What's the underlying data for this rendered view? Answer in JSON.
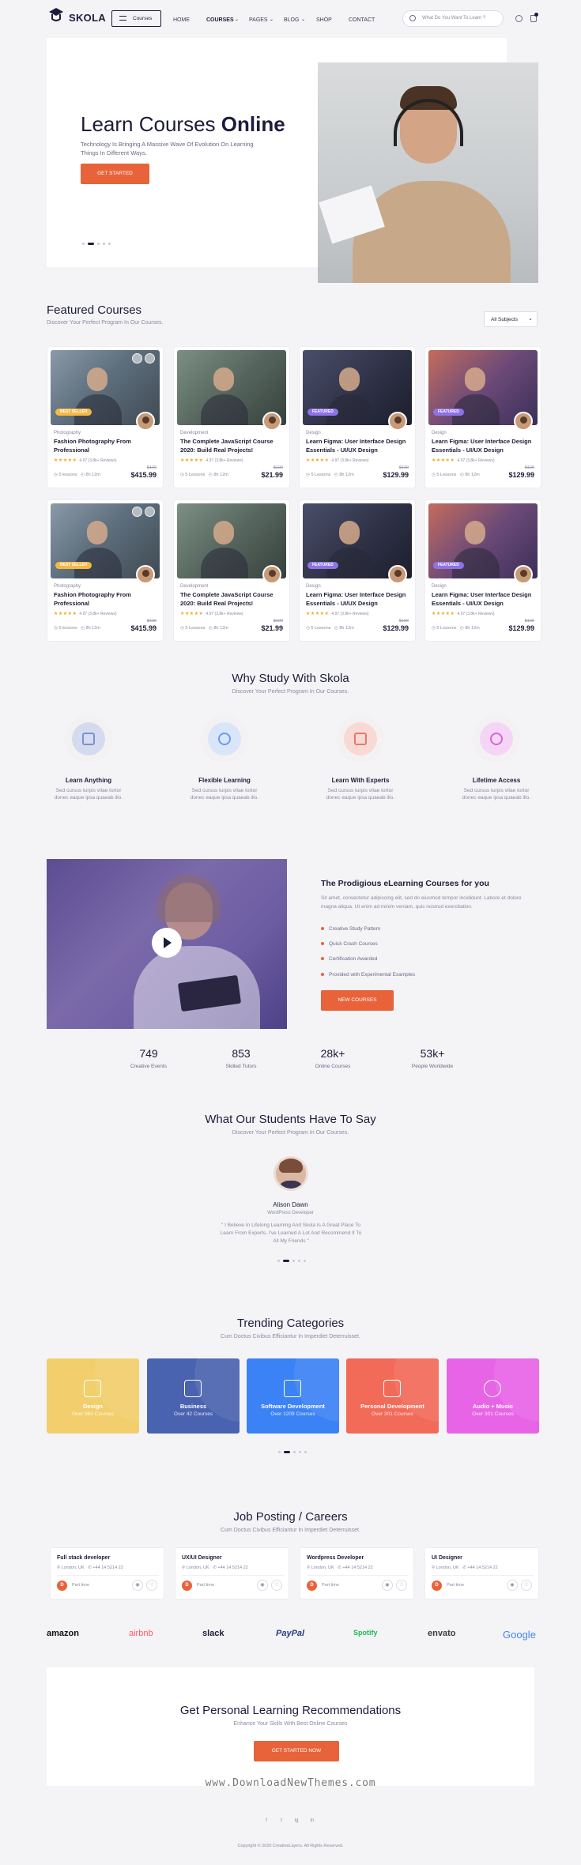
{
  "header": {
    "brand": "SKOLA",
    "courses_button": "Courses",
    "nav": [
      "HOME",
      "COURSES",
      "PAGES",
      "BLOG",
      "SHOP",
      "CONTACT"
    ],
    "search_placeholder": "What Do You Want To Learn ?"
  },
  "hero": {
    "title_light": "Learn Courses ",
    "title_bold": "Online",
    "subtitle": "Technology Is Bringing A Massive Wave Of Evolution On Learning Things In Different Ways.",
    "cta": "GET STARTED"
  },
  "featured": {
    "title": "Featured Courses",
    "subtitle": "Discover Your Perfect Program In Our Courses.",
    "filter": "All Subjects",
    "courses": [
      {
        "badge": "BEST SELLER",
        "category": "Photography",
        "title": "Fashion Photography From Professional",
        "rating": "4.97 (3.8k+ Reviews)",
        "old_price": "$120",
        "lessons": "5 lessons",
        "duration": "8h 12m",
        "price": "$415.99"
      },
      {
        "badge": "",
        "category": "Development",
        "title": "The Complete JavaScript Course 2020: Build Real Projects!",
        "rating": "4.97 (3.8k+ Reviews)",
        "old_price": "$120",
        "lessons": "5 Lessons",
        "duration": "8h 12m",
        "price": "$21.99"
      },
      {
        "badge": "FEATURED",
        "category": "Design",
        "title": "Learn Figma: User Interface Design Essentials - UI/UX Design",
        "rating": "4.97 (3.8k+ Reviews)",
        "old_price": "$120",
        "lessons": "5 Lessons",
        "duration": "8h 12m",
        "price": "$129.99"
      },
      {
        "badge": "FEATURED",
        "category": "Design",
        "title": "Learn Figma: User Interface Design Essentials - UI/UX Design",
        "rating": "4.97 (3.8k+ Reviews)",
        "old_price": "$120",
        "lessons": "5 Lessons",
        "duration": "8h 12m",
        "price": "$129.99"
      },
      {
        "badge": "BEST SELLER",
        "category": "Photography",
        "title": "Fashion Photography From Professional",
        "rating": "4.97 (3.8k+ Reviews)",
        "old_price": "$120",
        "lessons": "5 lessons",
        "duration": "8h 12m",
        "price": "$415.99"
      },
      {
        "badge": "",
        "category": "Development",
        "title": "The Complete JavaScript Course 2020: Build Real Projects!",
        "rating": "4.97 (3.8k+ Reviews)",
        "old_price": "$120",
        "lessons": "5 Lessons",
        "duration": "8h 12m",
        "price": "$21.99"
      },
      {
        "badge": "FEATURED",
        "category": "Design",
        "title": "Learn Figma: User Interface Design Essentials - UI/UX Design",
        "rating": "4.97 (3.8k+ Reviews)",
        "old_price": "$120",
        "lessons": "5 Lessons",
        "duration": "8h 12m",
        "price": "$129.99"
      },
      {
        "badge": "FEATURED",
        "category": "Design",
        "title": "Learn Figma: User Interface Design Essentials - UI/UX Design",
        "rating": "4.97 (3.8k+ Reviews)",
        "old_price": "$120",
        "lessons": "5 Lessons",
        "duration": "8h 12m",
        "price": "$129.99"
      }
    ]
  },
  "why": {
    "title": "Why Study With Skola",
    "subtitle": "Discover Your Perfect Program In Our Courses.",
    "items": [
      {
        "title": "Learn Anything",
        "desc": "Sed cursus turpis vitae tortor donec eaque ipsa quaeab illo."
      },
      {
        "title": "Flexible Learning",
        "desc": "Sed cursus turpis vitae tortor donec eaque ipsa quaeab illo."
      },
      {
        "title": "Learn With Experts",
        "desc": "Sed cursus turpis vitae tortor donec eaque ipsa quaeab illo."
      },
      {
        "title": "Lifetime Access",
        "desc": "Sed cursus turpis vitae tortor donec eaque ipsa quaeab illo."
      }
    ]
  },
  "about": {
    "title": "The Prodigious eLearning Courses for you",
    "text": "Sit amet, consectetur adipiscing elit, sed do eiusmod tempor incididunt. Labore et dolore magna aliqua. Ut enim ad minim veniam, quis nostrud exercitation.",
    "bullets": [
      "Creative Study Pattern",
      "Quick Crash Courses",
      "Certification Awarded",
      "Provided with Experimental Examples"
    ],
    "cta": "NEW COURSES"
  },
  "stats": [
    {
      "value": "749",
      "label": "Creative Events"
    },
    {
      "value": "853",
      "label": "Skilled Tutors"
    },
    {
      "value": "28k+",
      "label": "Online Courses"
    },
    {
      "value": "53k+",
      "label": "People Worldwide"
    }
  ],
  "testimonial": {
    "title": "What Our Students Have To Say",
    "subtitle": "Discover Your Perfect Program In Our Courses.",
    "name": "Alison Dawn",
    "role": "WordPress Developer",
    "quote": "\" I Believe In Lifelong Learning And Skola Is A Great Place To Learn From Experts. I've Learned A Lot And Recommend It To All My Friends \""
  },
  "trending": {
    "title": "Trending Categories",
    "subtitle": "Cum Doctus Civibus Efficiantur In Imperdiet Deterruisset.",
    "items": [
      {
        "name": "Design",
        "count": "Over 960 Courses",
        "color": "#f2cf6c"
      },
      {
        "name": "Business",
        "count": "Over 42 Courses",
        "color": "#4a63b0"
      },
      {
        "name": "Software Development",
        "count": "Over 1209 Courses",
        "color": "#3b82f6"
      },
      {
        "name": "Personal Development",
        "count": "Over 301 Courses",
        "color": "#f26a58"
      },
      {
        "name": "Audio + Music",
        "count": "Over 301 Courses",
        "color": "#e864e6"
      }
    ]
  },
  "jobs": {
    "title": "Job Posting / Careers",
    "subtitle": "Cum Doctus Civibus Efficiantur In Imperdiet Deterruisset.",
    "items": [
      {
        "title": "Full stack developer",
        "location": "London, UK",
        "phone": "+44 14 5214 22",
        "type": "Part time"
      },
      {
        "title": "UX/UI Designer",
        "location": "London, UK",
        "phone": "+44 14 5214 22",
        "type": "Part time"
      },
      {
        "title": "Wordpress Developer",
        "location": "London, UK",
        "phone": "+44 14 5214 22",
        "type": "Part time"
      },
      {
        "title": "UI Designer",
        "location": "London, UK",
        "phone": "+44 14 5214 22",
        "type": "Part time"
      }
    ]
  },
  "brands": [
    "amazon",
    "airbnb",
    "slack",
    "PayPal",
    "Spotify",
    "envato",
    "Google"
  ],
  "newsletter": {
    "title": "Get Personal Learning Recommendations",
    "subtitle": "Enhance Your Skills With Best Online Courses",
    "cta": "GET STARTED NOW"
  },
  "watermark": "www.DownloadNewThemes.com",
  "footer": {
    "social": [
      "f",
      "t",
      "ig",
      "in"
    ],
    "copyright": "Copyright © 2020 CreativeLayers. All Rights Reserved."
  },
  "colors": {
    "accent": "#e8623a",
    "dark": "#1c1c3a"
  }
}
